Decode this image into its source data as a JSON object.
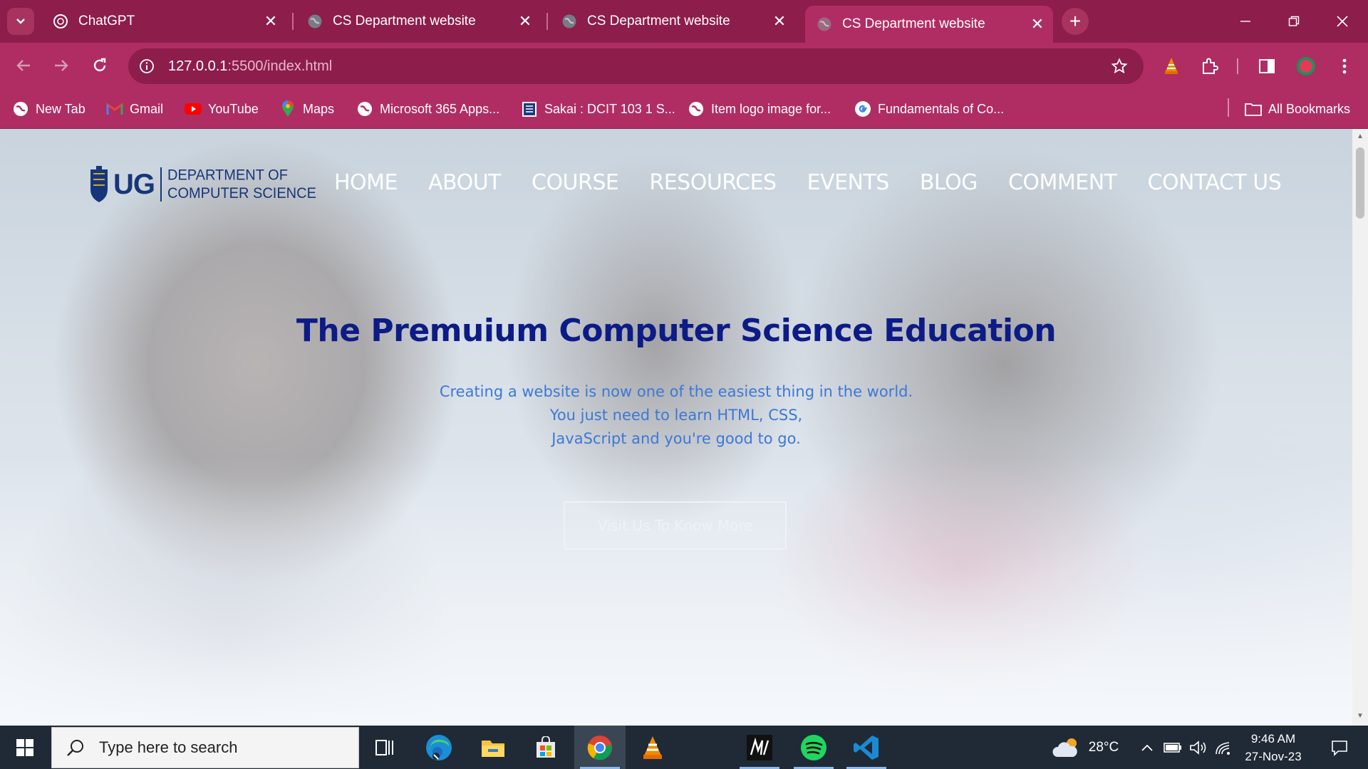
{
  "browser": {
    "tabs": [
      {
        "title": "ChatGPT",
        "favicon": "chatgpt-icon",
        "active": false
      },
      {
        "title": "CS Department website",
        "favicon": "globe-icon",
        "active": false
      },
      {
        "title": "CS Department website",
        "favicon": "globe-icon",
        "active": false
      },
      {
        "title": "CS Department website",
        "favicon": "globe-icon",
        "active": true
      }
    ],
    "new_tab_label": "+",
    "url_host": "127.0.0.1",
    "url_path": ":5500/index.html",
    "bookmarks": [
      {
        "label": "New Tab",
        "icon": "globe-icon"
      },
      {
        "label": "Gmail",
        "icon": "gmail-icon"
      },
      {
        "label": "YouTube",
        "icon": "youtube-icon"
      },
      {
        "label": "Maps",
        "icon": "maps-pin-icon"
      },
      {
        "label": "Microsoft 365 Apps...",
        "icon": "globe-icon"
      },
      {
        "label": "Sakai : DCIT 103 1 S...",
        "icon": "sakai-icon"
      },
      {
        "label": "Item logo image for...",
        "icon": "globe-icon"
      },
      {
        "label": "Fundamentals of Co...",
        "icon": "google-icon"
      }
    ],
    "all_bookmarks_label": "All Bookmarks",
    "colors": {
      "frame": "#8d1d4b",
      "toolbar": "#b02d63"
    }
  },
  "site": {
    "logo_ug": "UG",
    "logo_dept_line1": "DEPARTMENT OF",
    "logo_dept_line2": "COMPUTER SCIENCE",
    "nav": [
      "HOME",
      "ABOUT",
      "COURSE",
      "RESOURCES",
      "EVENTS",
      "BLOG",
      "COMMENT",
      "CONTACT US"
    ],
    "hero_title": "The Premuium Computer Science Education",
    "hero_lines": [
      "Creating a website is now one of the easiest thing in the world.",
      "You just need to learn HTML, CSS,",
      "JavaScript and you're good to go."
    ],
    "cta_label": "Visit Us To Know More",
    "colors": {
      "title": "#0c1b86",
      "subtitle": "#3c78d6",
      "logo": "#17367a"
    }
  },
  "taskbar": {
    "search_placeholder": "Type here to search",
    "apps": [
      "task-view-icon",
      "edge-icon",
      "file-explorer-icon",
      "microsoft-store-icon",
      "chrome-icon",
      "vlc-icon",
      "m-app-icon",
      "spotify-icon",
      "vscode-icon"
    ],
    "weather": "28°C",
    "time": "9:46 AM",
    "date": "27-Nov-23"
  }
}
